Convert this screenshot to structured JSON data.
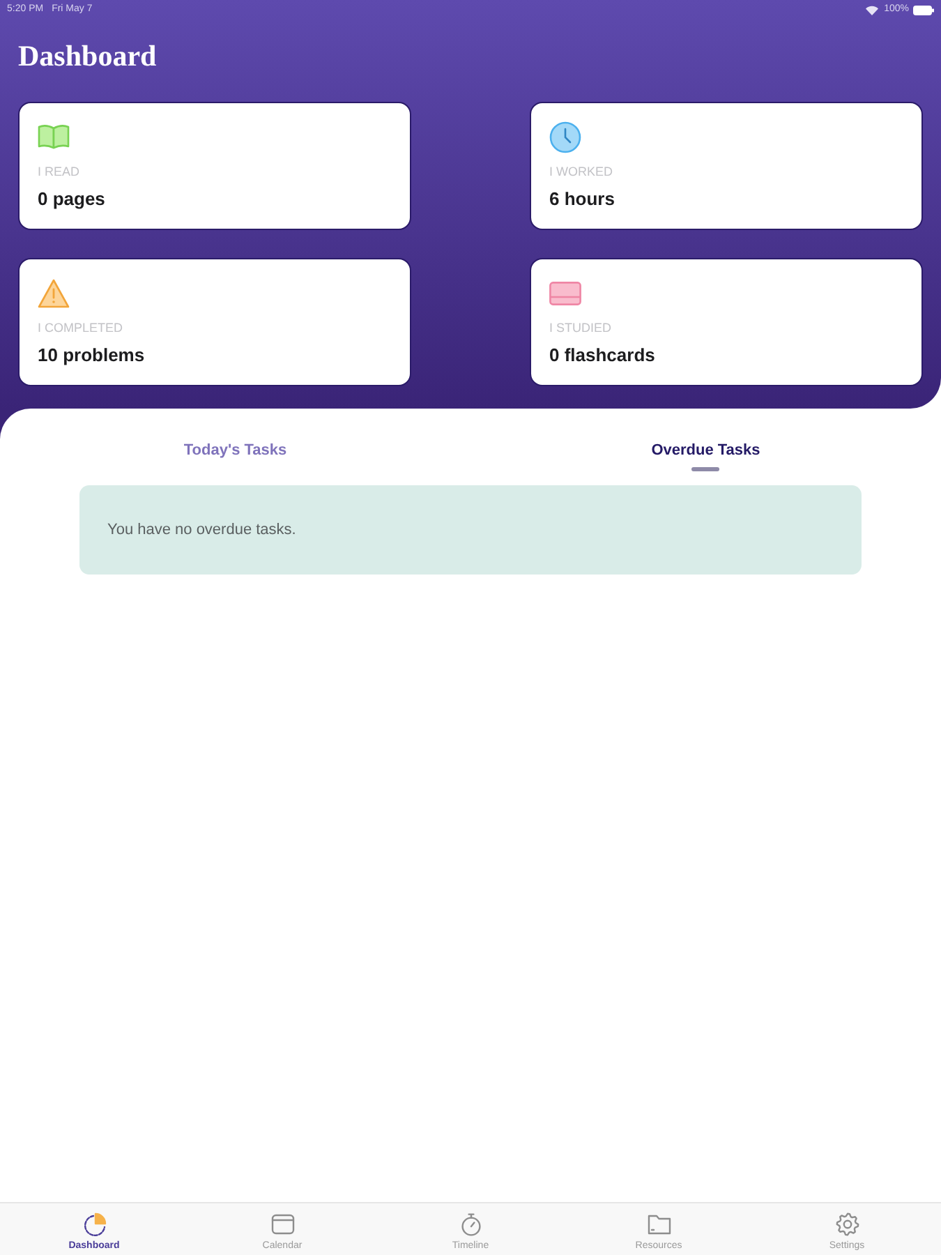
{
  "status_bar": {
    "time": "5:20 PM",
    "date": "Fri May 7",
    "battery": "100%"
  },
  "header": {
    "title": "Dashboard"
  },
  "stats": [
    {
      "kind": "book",
      "label": "I READ",
      "value": "0 pages"
    },
    {
      "kind": "clock",
      "label": "I WORKED",
      "value": "6 hours"
    },
    {
      "kind": "warning",
      "label": "I COMPLETED",
      "value": "10 problems"
    },
    {
      "kind": "card",
      "label": "I STUDIED",
      "value": "0 flashcards"
    }
  ],
  "task_tabs": [
    {
      "label": "Today's Tasks",
      "selected": false
    },
    {
      "label": "Overdue Tasks",
      "selected": true
    }
  ],
  "notice": {
    "text": "You have no overdue tasks."
  },
  "tab_bar": [
    {
      "kind": "dashboard",
      "label": "Dashboard",
      "selected": true
    },
    {
      "kind": "calendar",
      "label": "Calendar",
      "selected": false
    },
    {
      "kind": "timeline",
      "label": "Timeline",
      "selected": false
    },
    {
      "kind": "resources",
      "label": "Resources",
      "selected": false
    },
    {
      "kind": "settings",
      "label": "Settings",
      "selected": false
    }
  ]
}
